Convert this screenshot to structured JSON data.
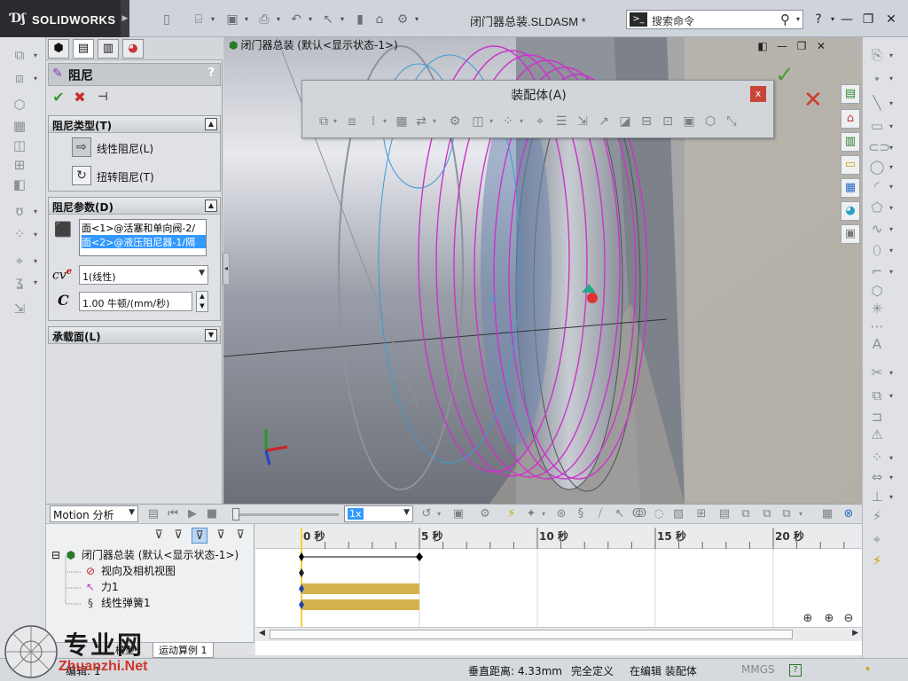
{
  "app": {
    "logo_text": "SOLIDWORKS",
    "document_title": "闭门器总装.SLDASM *",
    "search_placeholder": "搜索命令",
    "help_label": "?",
    "window_controls": [
      "minimize-icon",
      "restore-icon",
      "close-icon"
    ]
  },
  "property_manager": {
    "tabs": [
      "feature-manager-icon",
      "property-manager-icon",
      "configuration-manager-icon",
      "display-manager-icon"
    ],
    "title": "阻尼",
    "help": "?",
    "actions": [
      "ok-check-icon",
      "cancel-x-icon",
      "pin-icon"
    ],
    "damper_type": {
      "header": "阻尼类型(T)",
      "options": [
        {
          "label": "线性阻尼(L)",
          "icon": "linear-damper-icon",
          "selected": true
        },
        {
          "label": "扭转阻尼(T)",
          "icon": "torsional-damper-icon",
          "selected": false
        }
      ]
    },
    "damper_params": {
      "header": "阻尼参数(D)",
      "faces": [
        "面<1>@活塞和单向阀-2/",
        "面<2>@液压阻尼器-1/隔"
      ],
      "exponent_label_c": "c",
      "exponent_label_v": "v",
      "exponent_label_e": "e",
      "exponent_value": "1(线性)",
      "coef_label": "C",
      "coef_value": "1.00 牛顿/(mm/秒)"
    },
    "load_face": {
      "header": "承载面(L)"
    }
  },
  "viewport": {
    "breadcrumb": "闭门器总装 (默认<显示状态-1>)",
    "assembly_toolbar": {
      "title": "装配体(A)",
      "close": "x"
    }
  },
  "motion_study": {
    "study_type": "Motion 分析",
    "playback_speed": "1x",
    "timeline_labels": [
      "0 秒",
      "5 秒",
      "10 秒",
      "15 秒",
      "20 秒"
    ],
    "timeline_seconds": [
      0,
      5,
      10,
      15,
      20
    ],
    "tree": [
      {
        "label": "闭门器总装 (默认<显示状态-1>)",
        "icon": "assembly-icon",
        "expander": "⊟"
      },
      {
        "label": "视向及相机视图",
        "icon": "camera-view-icon"
      },
      {
        "label": "力1",
        "icon": "force-arrow-icon"
      },
      {
        "label": "线性弹簧1",
        "icon": "linear-spring-icon"
      }
    ],
    "tabs": [
      "模型",
      "运动算例 1"
    ],
    "keys": {
      "assembly_start": 0,
      "assembly_end": 5,
      "force_end": 5,
      "spring_end": 5
    }
  },
  "status_bar": {
    "left": "编辑: 1",
    "distance": "垂直距离: 4.33mm",
    "definition": "完全定义",
    "editing": "在编辑 装配体",
    "units": "MMGS",
    "help": "?"
  },
  "watermark": {
    "cn": "专业网",
    "en": "Zhuanzhi.Net"
  },
  "colors": {
    "accent_magenta": "#cc33cc",
    "bar_gold": "#d4b24c",
    "selection_blue": "#3399ff"
  }
}
